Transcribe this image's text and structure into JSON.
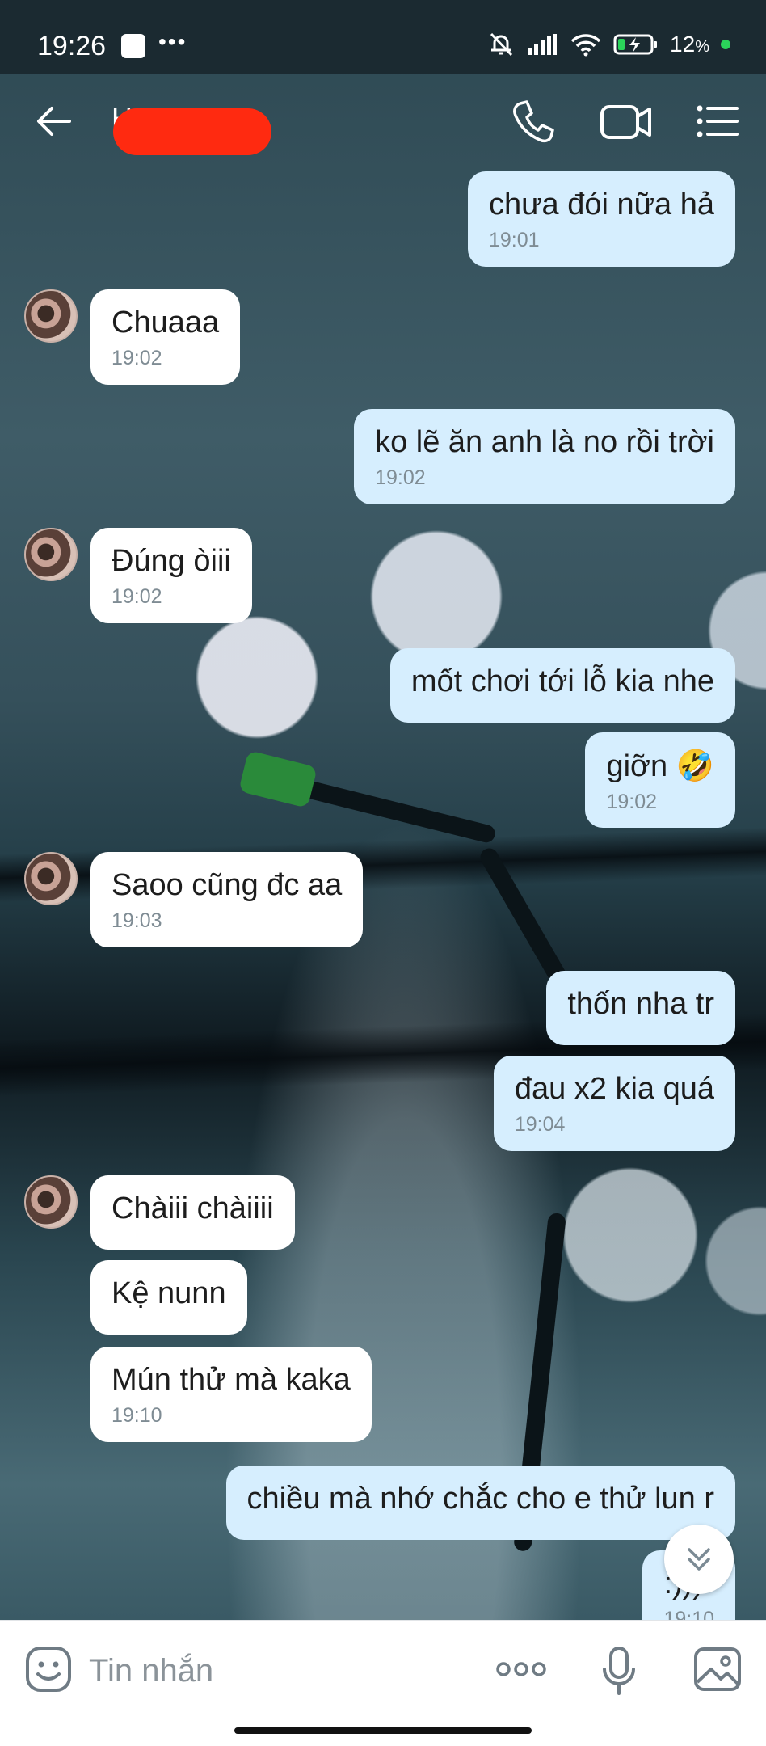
{
  "status_bar": {
    "time": "19:26",
    "dots": "•••",
    "battery_text": "12",
    "battery_unit": "%"
  },
  "header": {
    "contact_name": "H"
  },
  "messages": [
    {
      "text": "chưa đói nữa hả",
      "time": "19:01"
    },
    {
      "text": "Chuaaa",
      "time": "19:02"
    },
    {
      "text": "ko lẽ ăn anh là no rồi trời",
      "time": "19:02"
    },
    {
      "text": "Đúng òiii",
      "time": "19:02"
    },
    {
      "text": "mốt chơi tới lỗ kia nhe",
      "time": ""
    },
    {
      "text": "giỡn 🤣",
      "time": "19:02"
    },
    {
      "text": "Saoo cũng đc aa",
      "time": "19:03"
    },
    {
      "text": "thốn nha tr",
      "time": ""
    },
    {
      "text": "đau x2 kia quá",
      "time": "19:04"
    },
    {
      "text": "Chàiii chàiiii",
      "time": ""
    },
    {
      "text": "Kệ nunn",
      "time": ""
    },
    {
      "text": "Mún thử mà kaka",
      "time": "19:10"
    },
    {
      "text": "chiều mà nhớ chắc cho e thử lun r",
      "time": ""
    },
    {
      "text": ":)))",
      "time": "19:10"
    }
  ],
  "input": {
    "placeholder": "Tin nhắn"
  },
  "colors": {
    "outgoing_bubble": "#d6eefe",
    "incoming_bubble": "#ffffff",
    "redaction": "#ff2a10",
    "status_dot": "#2bd45a"
  },
  "icons": [
    "back-arrow-icon",
    "phone-icon",
    "video-camera-icon",
    "menu-list-icon",
    "double-chevron-down-icon",
    "sticker-icon",
    "more-dots-icon",
    "microphone-icon",
    "gallery-icon"
  ]
}
